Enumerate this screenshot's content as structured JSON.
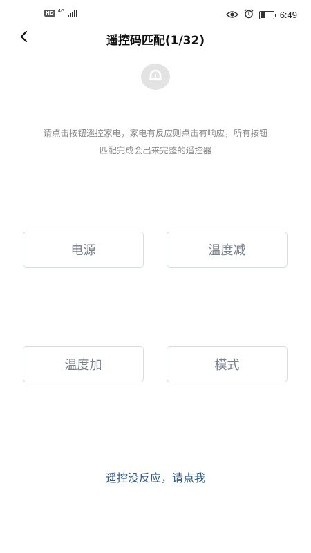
{
  "status_bar": {
    "hd": "HD",
    "network": "4G",
    "time": "6:49",
    "battery_level": 0.35
  },
  "header": {
    "title": "遥控码匹配(1/32)"
  },
  "instruction": {
    "line1": "请点击按钮遥控家电，家电有反应则点击有响应，所有按钮",
    "line2": "匹配完成会出来完整的遥控器"
  },
  "buttons": {
    "power": "电源",
    "temp_down": "温度减",
    "temp_up": "温度加",
    "mode": "模式"
  },
  "help_link": "遥控没反应，请点我",
  "colors": {
    "link": "#2f5a8a",
    "button_text": "#7a828c",
    "button_border": "#d9dde3",
    "instruction_text": "#8a8a8a"
  }
}
